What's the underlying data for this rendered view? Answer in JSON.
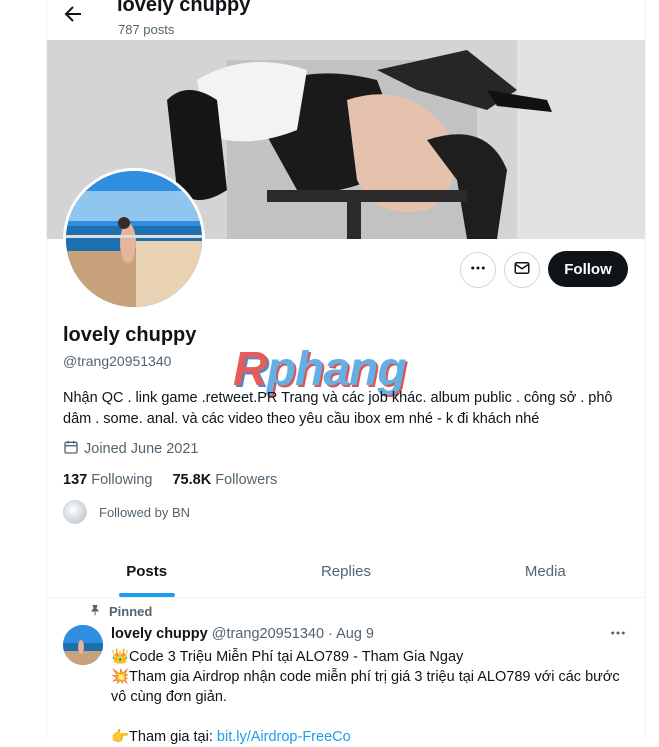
{
  "header": {
    "title": "lovely chuppy",
    "posts_count": "787 posts"
  },
  "profile": {
    "name": "lovely chuppy",
    "handle": "@trang20951340",
    "bio": "Nhận QC . link game .retweet.PR Trang và các job khác. album public . công sở . phô dâm . some. anal. và các video theo yêu cầu ibox em nhé - k đi khách nhé",
    "joined": "Joined June 2021",
    "following_count": "137",
    "following_label": "Following",
    "followers_count": "75.8K",
    "followers_label": "Followers",
    "followed_by": "Followed by BN",
    "follow_button": "Follow"
  },
  "watermark": {
    "part1": "R",
    "part2": "phang"
  },
  "tabs": [
    {
      "label": "Posts",
      "active": true
    },
    {
      "label": "Replies",
      "active": false
    },
    {
      "label": "Media",
      "active": false
    }
  ],
  "pinned_tweet": {
    "pinned_label": "Pinned",
    "author": "lovely chuppy",
    "meta": "@trang20951340 · Aug 9",
    "line1": "👑Code 3 Triệu Miễn Phí tại ALO789 - Tham Gia Ngay",
    "line2": "💥Tham gia Airdrop nhận code miễn phí trị giá 3 triệu tại ALO789 với các bước vô cùng đơn giản.",
    "line3_prefix": "👉Tham gia tại: ",
    "line3_link": "bit.ly/Airdrop-FreeCo"
  },
  "colors": {
    "accent": "#1d9bf0",
    "text": "#0f1419",
    "muted": "#536471",
    "follow_bg": "#0f1419"
  },
  "icons": [
    "back-arrow-icon",
    "more-icon",
    "mail-icon",
    "calendar-icon",
    "pin-icon"
  ]
}
